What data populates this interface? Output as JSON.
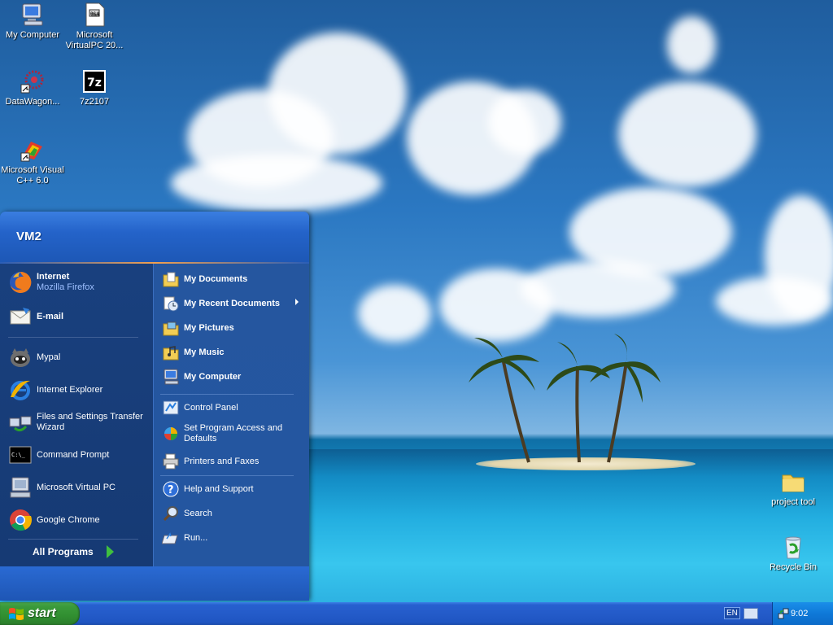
{
  "desktop": {
    "icons_left": [
      {
        "label": "My Computer",
        "icon": "my-computer-icon"
      },
      {
        "label": "Microsoft VirtualPC 20...",
        "icon": "virtualpc-file-icon"
      },
      {
        "label": "DataWagon...",
        "icon": "datawagon-icon"
      },
      {
        "label": "7z2107",
        "icon": "sevenzip-icon"
      },
      {
        "label": "Microsoft Visual C++ 6.0",
        "icon": "visual-cpp-icon"
      }
    ],
    "icons_right": [
      {
        "label": "project tool",
        "icon": "folder-icon"
      },
      {
        "label": "Recycle Bin",
        "icon": "recycle-bin-icon"
      }
    ]
  },
  "start_menu": {
    "user": "VM2",
    "pinned": [
      {
        "main": "Internet",
        "sub": "Mozilla Firefox",
        "icon": "firefox-icon"
      },
      {
        "main": "E-mail",
        "sub": "",
        "icon": "email-icon"
      }
    ],
    "recent": [
      {
        "label": "Mypal",
        "icon": "mypal-icon"
      },
      {
        "label": "Internet Explorer",
        "icon": "internet-explorer-icon"
      },
      {
        "label": "Files and Settings Transfer Wizard",
        "icon": "transfer-wizard-icon"
      },
      {
        "label": "Command Prompt",
        "icon": "command-prompt-icon"
      },
      {
        "label": "Microsoft Virtual PC",
        "icon": "virtual-pc-icon"
      },
      {
        "label": "Google Chrome",
        "icon": "chrome-icon"
      }
    ],
    "all_programs": "All Programs",
    "right_places": [
      {
        "label": "My Documents",
        "icon": "my-documents-icon"
      },
      {
        "label": "My Recent Documents",
        "icon": "recent-documents-icon"
      },
      {
        "label": "My Pictures",
        "icon": "my-pictures-icon"
      },
      {
        "label": "My Music",
        "icon": "my-music-icon"
      },
      {
        "label": "My Computer",
        "icon": "my-computer-icon"
      }
    ],
    "right_settings": [
      {
        "label": "Control Panel",
        "icon": "control-panel-icon"
      },
      {
        "label": "Set Program Access and Defaults",
        "icon": "program-access-icon"
      },
      {
        "label": "Printers and Faxes",
        "icon": "printer-icon"
      }
    ],
    "right_tools": [
      {
        "label": "Help and Support",
        "icon": "help-icon"
      },
      {
        "label": "Search",
        "icon": "search-icon"
      },
      {
        "label": "Run...",
        "icon": "run-icon"
      }
    ]
  },
  "taskbar": {
    "start_label": "start",
    "language": "EN",
    "time": "9:02"
  }
}
